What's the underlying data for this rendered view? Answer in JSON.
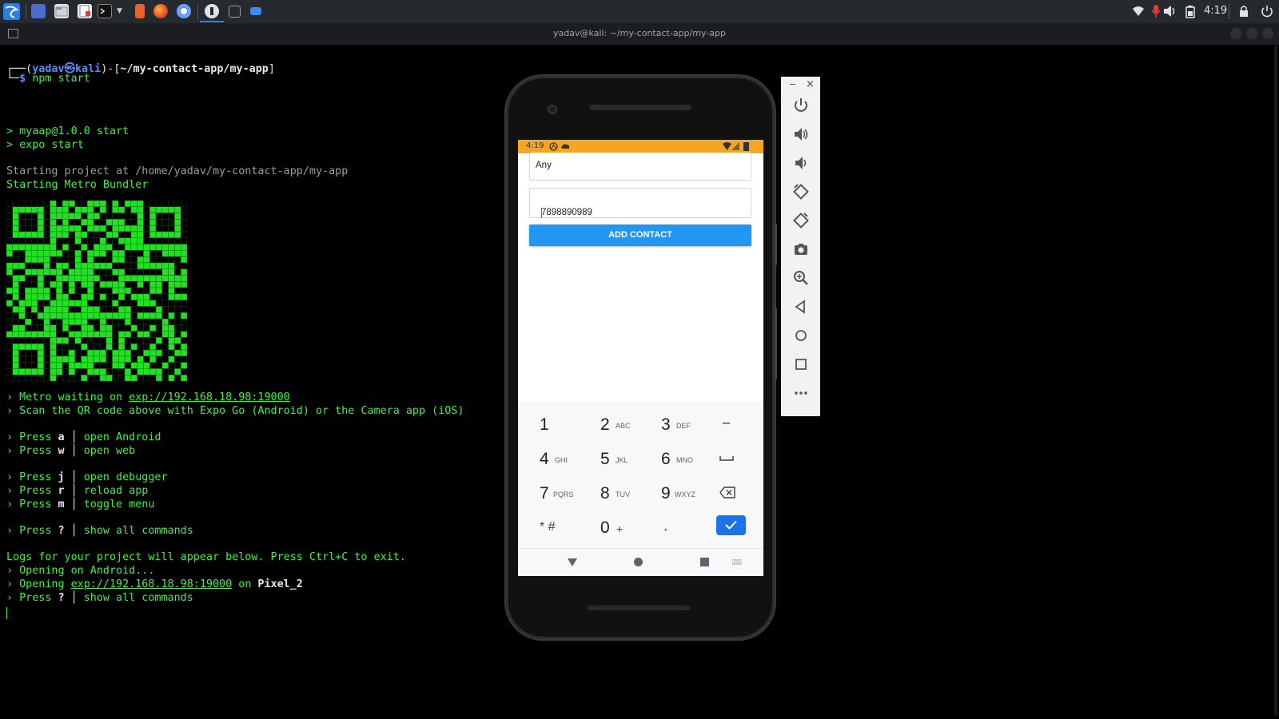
{
  "taskbar": {
    "clock": "4:19",
    "icons": [
      "kali-menu-icon",
      "workspace-icon",
      "file-manager-icon",
      "text-editor-icon",
      "terminal-icon",
      "burp-icon",
      "firefox-icon",
      "chromium-icon",
      "expo-icon",
      "terminal-window-icon",
      "folder-icon"
    ],
    "tray_icons": [
      "network-icon",
      "microphone-icon",
      "volume-icon",
      "battery-icon",
      "lock-icon",
      "power-icon"
    ]
  },
  "window": {
    "title": "yadav@kali: ~/my-contact-app/my-app"
  },
  "terminal": {
    "prompt_top": "┌──(",
    "prompt_user": "yadav㉿kali",
    "prompt_mid": ")-[",
    "prompt_path": "~/my-contact-app/my-app",
    "prompt_end": "]",
    "prompt_bottom": "└─",
    "prompt_dollar": "$",
    "command": " npm start",
    "lines": [
      "> myaap@1.0.0 start",
      "> expo start"
    ],
    "starting_project": "Starting project at /home/yadav/my-contact-app/my-app",
    "starting_metro": "Starting Metro Bundler",
    "metro_prefix": "› Metro waiting on ",
    "metro_url": "exp://192.168.18.98:19000",
    "scan_line": "› Scan the QR code above with Expo Go (Android) or the Camera app (iOS)",
    "press": "› Press ",
    "sep": " │ ",
    "keys": [
      {
        "key": "a",
        "action": "open Android"
      },
      {
        "key": "w",
        "action": "open web"
      },
      {
        "key": "j",
        "action": "open debugger"
      },
      {
        "key": "r",
        "action": "reload app"
      },
      {
        "key": "m",
        "action": "toggle menu"
      },
      {
        "key": "?",
        "action": "show all commands"
      }
    ],
    "logs_line": "Logs for your project will appear below. Press Ctrl+C to exit.",
    "opening_android": "› Opening on Android...",
    "opening_prefix": "› Opening ",
    "opening_url": "exp://192.168.18.98:19000",
    "opening_on": " on ",
    "opening_device": "Pixel_2",
    "final_key": {
      "key": "?",
      "action": "show all commands"
    }
  },
  "phone": {
    "status_time": "4:19",
    "name_field_value": "Any",
    "phone_field_value": "7898890989",
    "add_button_label": "ADD CONTACT",
    "keypad": [
      {
        "d": "1",
        "l": ""
      },
      {
        "d": "2",
        "l": "ABC"
      },
      {
        "d": "3",
        "l": "DEF"
      },
      {
        "d": "−",
        "l": ""
      },
      {
        "d": "4",
        "l": "GHI"
      },
      {
        "d": "5",
        "l": "JKL"
      },
      {
        "d": "6",
        "l": "MNO"
      },
      {
        "d": "␣",
        "l": ""
      },
      {
        "d": "7",
        "l": "PQRS"
      },
      {
        "d": "8",
        "l": "TUV"
      },
      {
        "d": "9",
        "l": "WXYZ"
      },
      {
        "d": "⌫",
        "l": ""
      },
      {
        "d": "* #",
        "l": ""
      },
      {
        "d": "0",
        "l": "+"
      },
      {
        "d": ".",
        "l": ""
      },
      {
        "d": "✓",
        "l": ""
      }
    ]
  },
  "emulator_controls": [
    "power-icon",
    "volume-up-icon",
    "volume-down-icon",
    "rotate-left-icon",
    "rotate-right-icon",
    "camera-icon",
    "zoom-icon",
    "back-icon",
    "home-icon",
    "overview-icon",
    "more-icon"
  ],
  "emulator_window": {
    "minimize": "−",
    "close": "×"
  }
}
